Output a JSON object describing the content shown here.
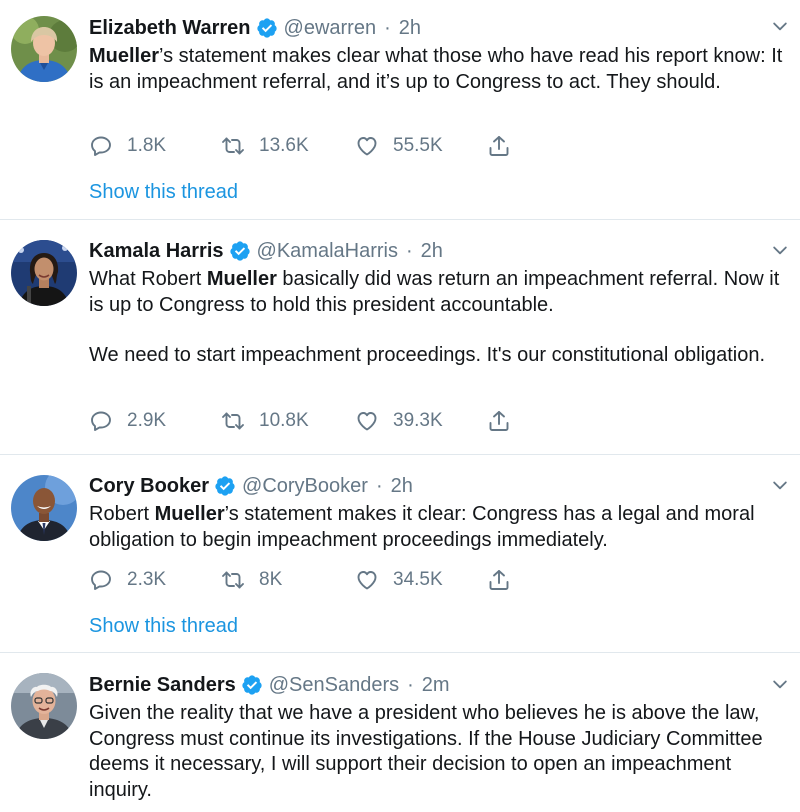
{
  "colors": {
    "accent": "#1da1f2",
    "link": "#1b95e0",
    "muted": "#657786",
    "text": "#14171a"
  },
  "tweets": [
    {
      "name": "Elizabeth Warren",
      "handle": "@ewarren",
      "separator": "·",
      "time": "2h",
      "bold": "Mueller",
      "text1": "’s statement makes clear what those who have read his report know: It is an impeachment referral, and it’s up to Congress to act. They should.",
      "replies": "1.8K",
      "retweets": "13.6K",
      "likes": "55.5K",
      "thread_link": "Show this thread"
    },
    {
      "name": "Kamala Harris",
      "handle": "@KamalaHarris",
      "separator": "·",
      "time": "2h",
      "pre": "What Robert ",
      "bold": "Mueller",
      "text1": " basically did was return an impeachment referral. Now it is up to Congress to hold this president accountable.",
      "text2": "We need to start impeachment proceedings. It's our constitutional obligation.",
      "replies": "2.9K",
      "retweets": "10.8K",
      "likes": "39.3K"
    },
    {
      "name": "Cory Booker",
      "handle": "@CoryBooker",
      "separator": "·",
      "time": "2h",
      "pre": "Robert ",
      "bold": "Mueller",
      "text1": "’s statement makes it clear: Congress has a legal and moral obligation to begin impeachment proceedings immediately.",
      "replies": "2.3K",
      "retweets": "8K",
      "likes": "34.5K",
      "thread_link": "Show this thread"
    },
    {
      "name": "Bernie Sanders",
      "handle": "@SenSanders",
      "separator": "·",
      "time": "2m",
      "text1": "Given the reality that we have a president who believes he is above the law, Congress must continue its investigations. If the House Judiciary Committee deems it necessary, I will support their decision to open an impeachment inquiry."
    }
  ]
}
